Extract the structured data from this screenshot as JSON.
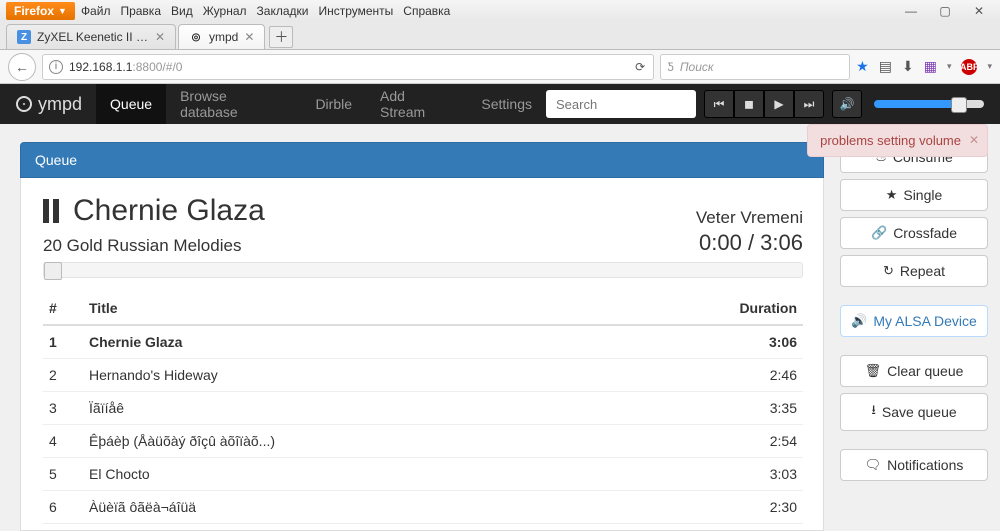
{
  "browser": {
    "name": "Firefox",
    "menu": {
      "file": "Файл",
      "edit": "Правка",
      "view": "Вид",
      "history": "Журнал",
      "bookmarks": "Закладки",
      "tools": "Инструменты",
      "help": "Справка"
    },
    "tabs": {
      "t0": {
        "title": "ZyXEL Keenetic II Системный …"
      },
      "t1": {
        "title": "ympd"
      }
    },
    "url": {
      "host": "192.168.1.1",
      "portpath": ":8800/#/0"
    },
    "search_placeholder": "Поиск"
  },
  "nav": {
    "brand": "ympd",
    "links": {
      "queue": "Queue",
      "browse": "Browse database",
      "dirble": "Dirble",
      "add": "Add Stream",
      "settings": "Settings"
    },
    "search_placeholder": "Search"
  },
  "panel": {
    "title": "Queue"
  },
  "now_playing": {
    "title": "Chernie Glaza",
    "album": "20 Gold Russian Melodies",
    "artist": "Veter Vremeni",
    "elapsed": "0:00",
    "total": "3:06"
  },
  "table": {
    "headers": {
      "num": "#",
      "title": "Title",
      "duration": "Duration"
    },
    "rows": [
      {
        "n": "1",
        "title": "Chernie Glaza",
        "dur": "3:06",
        "current": true
      },
      {
        "n": "2",
        "title": "Hernando's Hideway",
        "dur": "2:46",
        "current": false
      },
      {
        "n": "3",
        "title": "Ïãïíåê",
        "dur": "3:35",
        "current": false
      },
      {
        "n": "4",
        "title": "Êþáèþ (Åàüõàý ðîçû àõîïàõ...)",
        "dur": "2:54",
        "current": false
      },
      {
        "n": "5",
        "title": "El Chocto",
        "dur": "3:03",
        "current": false
      },
      {
        "n": "6",
        "title": "Àüèïã ôãëà¬áîüä",
        "dur": "2:30",
        "current": false
      }
    ]
  },
  "sidebar": {
    "consume": "Consume",
    "single": "Single",
    "crossfade": "Crossfade",
    "repeat": "Repeat",
    "alsa": "My ALSA Device",
    "clear": "Clear queue",
    "save": "Save queue",
    "notifications": "Notifications"
  },
  "alert": {
    "text": "problems setting volume"
  }
}
